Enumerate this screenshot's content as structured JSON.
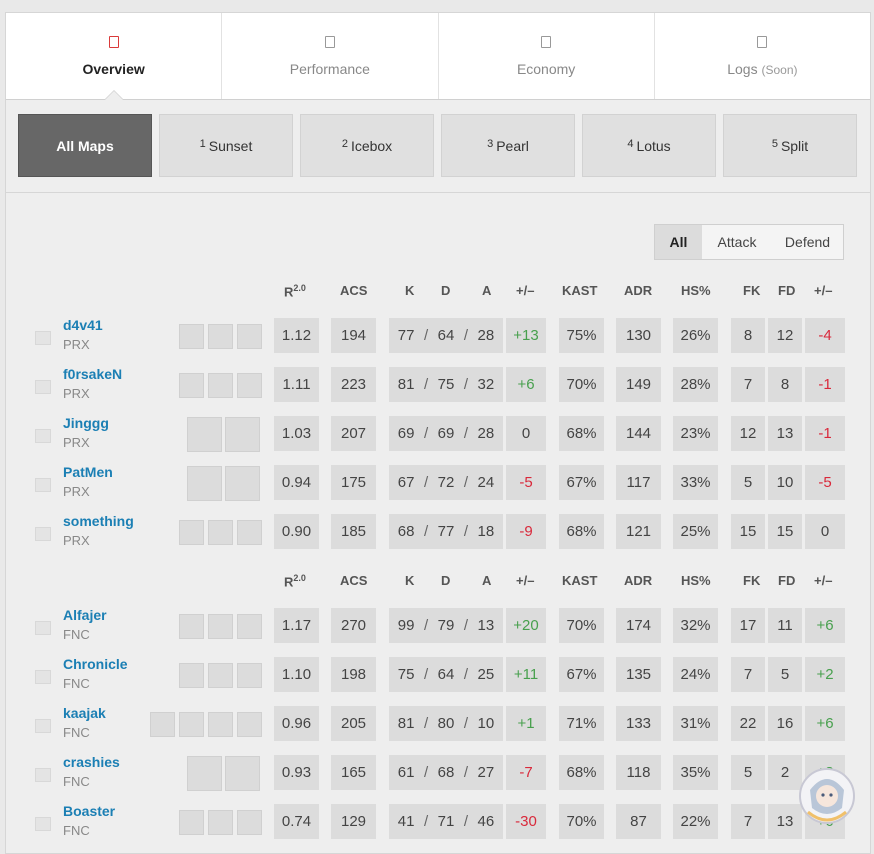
{
  "tabs": [
    {
      "label": "Overview",
      "sub": "",
      "active": true
    },
    {
      "label": "Performance",
      "sub": "",
      "active": false
    },
    {
      "label": "Economy",
      "sub": "",
      "active": false
    },
    {
      "label": "Logs",
      "sub": "(Soon)",
      "active": false
    }
  ],
  "maps": [
    {
      "num": "",
      "name": "All Maps",
      "active": true
    },
    {
      "num": "1",
      "name": "Sunset",
      "active": false
    },
    {
      "num": "2",
      "name": "Icebox",
      "active": false
    },
    {
      "num": "3",
      "name": "Pearl",
      "active": false
    },
    {
      "num": "4",
      "name": "Lotus",
      "active": false
    },
    {
      "num": "5",
      "name": "Split",
      "active": false
    }
  ],
  "side_filter": {
    "all": "All",
    "attack": "Attack",
    "defend": "Defend"
  },
  "headers": {
    "rating": "R",
    "rating_sup": "2.0",
    "acs": "ACS",
    "k": "K",
    "d": "D",
    "a": "A",
    "pm": "+/–",
    "kast": "KAST",
    "adr": "ADR",
    "hs": "HS%",
    "fk": "FK",
    "fd": "FD",
    "fpm": "+/–"
  },
  "teams": [
    {
      "players": [
        {
          "name": "d4v41",
          "team": "PRX",
          "agents": 3,
          "rating": "1.12",
          "acs": "194",
          "k": "77",
          "d": "64",
          "a": "28",
          "pm": "+13",
          "kast": "75%",
          "adr": "130",
          "hs": "26%",
          "fk": "8",
          "fd": "12",
          "fpm": "-4"
        },
        {
          "name": "f0rsakeN",
          "team": "PRX",
          "agents": 3,
          "rating": "1.11",
          "acs": "223",
          "k": "81",
          "d": "75",
          "a": "32",
          "pm": "+6",
          "kast": "70%",
          "adr": "149",
          "hs": "28%",
          "fk": "7",
          "fd": "8",
          "fpm": "-1"
        },
        {
          "name": "Jinggg",
          "team": "PRX",
          "agents": 2,
          "rating": "1.03",
          "acs": "207",
          "k": "69",
          "d": "69",
          "a": "28",
          "pm": "0",
          "kast": "68%",
          "adr": "144",
          "hs": "23%",
          "fk": "12",
          "fd": "13",
          "fpm": "-1"
        },
        {
          "name": "PatMen",
          "team": "PRX",
          "agents": 2,
          "rating": "0.94",
          "acs": "175",
          "k": "67",
          "d": "72",
          "a": "24",
          "pm": "-5",
          "kast": "67%",
          "adr": "117",
          "hs": "33%",
          "fk": "5",
          "fd": "10",
          "fpm": "-5"
        },
        {
          "name": "something",
          "team": "PRX",
          "agents": 3,
          "rating": "0.90",
          "acs": "185",
          "k": "68",
          "d": "77",
          "a": "18",
          "pm": "-9",
          "kast": "68%",
          "adr": "121",
          "hs": "25%",
          "fk": "15",
          "fd": "15",
          "fpm": "0"
        }
      ]
    },
    {
      "players": [
        {
          "name": "Alfajer",
          "team": "FNC",
          "agents": 3,
          "rating": "1.17",
          "acs": "270",
          "k": "99",
          "d": "79",
          "a": "13",
          "pm": "+20",
          "kast": "70%",
          "adr": "174",
          "hs": "32%",
          "fk": "17",
          "fd": "11",
          "fpm": "+6"
        },
        {
          "name": "Chronicle",
          "team": "FNC",
          "agents": 3,
          "rating": "1.10",
          "acs": "198",
          "k": "75",
          "d": "64",
          "a": "25",
          "pm": "+11",
          "kast": "67%",
          "adr": "135",
          "hs": "24%",
          "fk": "7",
          "fd": "5",
          "fpm": "+2"
        },
        {
          "name": "kaajak",
          "team": "FNC",
          "agents": 4,
          "rating": "0.96",
          "acs": "205",
          "k": "81",
          "d": "80",
          "a": "10",
          "pm": "+1",
          "kast": "71%",
          "adr": "133",
          "hs": "31%",
          "fk": "22",
          "fd": "16",
          "fpm": "+6"
        },
        {
          "name": "crashies",
          "team": "FNC",
          "agents": 2,
          "rating": "0.93",
          "acs": "165",
          "k": "61",
          "d": "68",
          "a": "27",
          "pm": "-7",
          "kast": "68%",
          "adr": "118",
          "hs": "35%",
          "fk": "5",
          "fd": "2",
          "fpm": "+3"
        },
        {
          "name": "Boaster",
          "team": "FNC",
          "agents": 3,
          "rating": "0.74",
          "acs": "129",
          "k": "41",
          "d": "71",
          "a": "46",
          "pm": "-30",
          "kast": "70%",
          "adr": "87",
          "hs": "22%",
          "fk": "7",
          "fd": "13",
          "fpm": "+6"
        }
      ]
    }
  ]
}
